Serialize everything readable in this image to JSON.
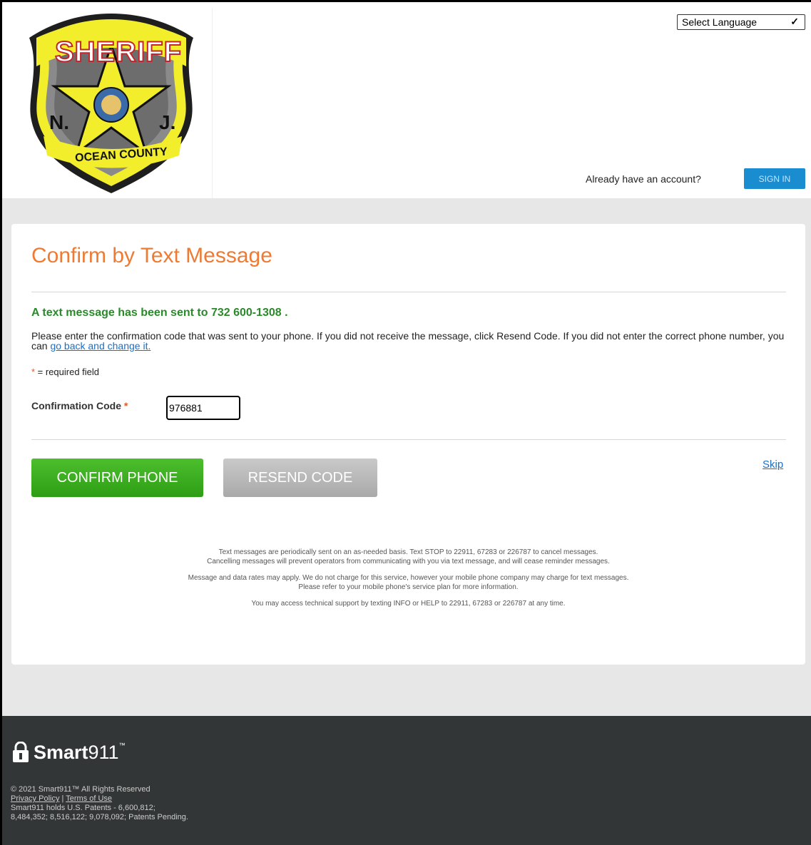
{
  "header": {
    "logo": {
      "word_top": "SHERIFF",
      "left_letter": "N.",
      "right_letter": "J.",
      "bottom_text": "OCEAN COUNTY"
    },
    "language_select": {
      "value": "Select Language"
    },
    "already_text": "Already have an account?",
    "signin_label": "SIGN IN"
  },
  "card": {
    "title": "Confirm by Text Message",
    "sent_message": "A text message has been sent to 732 600-1308 .",
    "instructions_prefix": "Please enter the confirmation code that was sent to your phone. If you did not receive the message, click Resend Code. If you did not enter the correct phone number, you can ",
    "instructions_link": "go back and change it.",
    "required_asterisk": "*",
    "required_text": " = required field",
    "code_label": "Confirmation Code",
    "code_value": "976881",
    "confirm_label": "CONFIRM PHONE",
    "resend_label": "RESEND CODE",
    "skip_label": "Skip",
    "notes": {
      "p1_line1": "Text messages are periodically sent on an as-needed basis. Text STOP to 22911, 67283 or 226787 to cancel messages.",
      "p1_line2": "Cancelling messages will prevent operators from communicating with you via text message, and will cease reminder messages.",
      "p2_line1": "Message and data rates may apply. We do not charge for this service, however your mobile phone company may charge for text messages.",
      "p2_line2": "Please refer to your mobile phone's service plan for more information.",
      "p3": "You may access technical support by texting INFO or HELP to 22911, 67283 or 226787 at any time."
    }
  },
  "footer": {
    "brand_bold": "Smart",
    "brand_light": "911",
    "brand_tm": "™",
    "copyright": "© 2021 Smart911™ All Rights Reserved",
    "privacy": "Privacy Policy",
    "separator": "|",
    "terms": "Terms of Use",
    "patents1": "Smart911 holds U.S. Patents - 6,600,812;",
    "patents2": "8,484,352; 8,516,122; 9,078,092; Patents Pending."
  },
  "colors": {
    "accent_orange": "#ee7b33",
    "success_green": "#2a8a2a",
    "button_green": "#3aae1f",
    "signin_blue": "#1a8dd0",
    "footer_bg": "#333636"
  }
}
